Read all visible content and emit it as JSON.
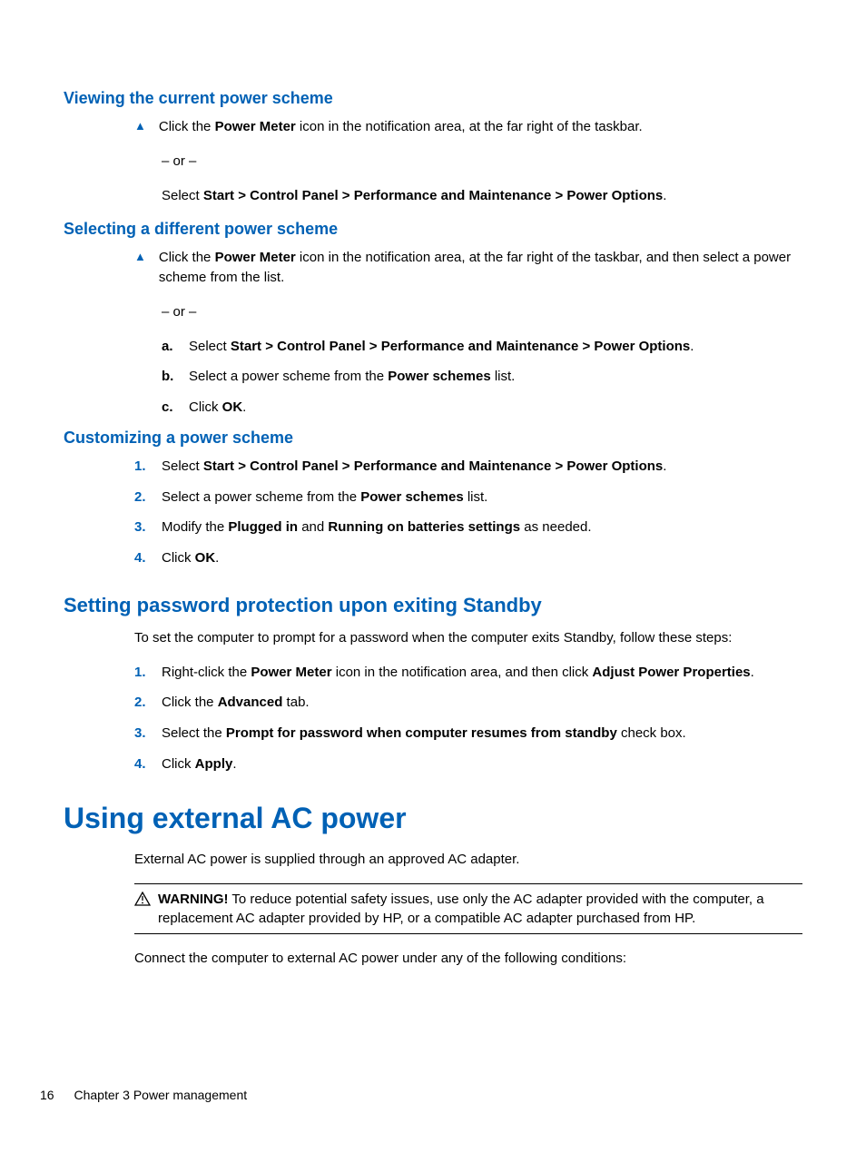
{
  "sec1": {
    "heading": "Viewing the current power scheme",
    "bullet_pre": "Click the ",
    "bullet_b1": "Power Meter",
    "bullet_post": " icon in the notification area, at the far right of the taskbar.",
    "or": "– or –",
    "line2_pre": "Select ",
    "line2_b": "Start > Control Panel > Performance and Maintenance > Power Options",
    "line2_post": "."
  },
  "sec2": {
    "heading": "Selecting a different power scheme",
    "bullet_pre": "Click the ",
    "bullet_b1": "Power Meter",
    "bullet_post": " icon in the notification area, at the far right of the taskbar, and then select a power scheme from the list.",
    "or": "– or –",
    "a_label": "a.",
    "a_pre": "Select ",
    "a_b": "Start > Control Panel > Performance and Maintenance > Power Options",
    "a_post": ".",
    "b_label": "b.",
    "b_pre": "Select a power scheme from the ",
    "b_b": "Power schemes",
    "b_post": " list.",
    "c_label": "c.",
    "c_pre": "Click ",
    "c_b": "OK",
    "c_post": "."
  },
  "sec3": {
    "heading": "Customizing a power scheme",
    "n1": "1.",
    "s1_pre": "Select ",
    "s1_b": "Start > Control Panel > Performance and Maintenance > Power Options",
    "s1_post": ".",
    "n2": "2.",
    "s2_pre": "Select a power scheme from the ",
    "s2_b": "Power schemes",
    "s2_post": " list.",
    "n3": "3.",
    "s3_pre": "Modify the ",
    "s3_b1": "Plugged in",
    "s3_mid": " and ",
    "s3_b2": "Running on batteries settings",
    "s3_post": " as needed.",
    "n4": "4.",
    "s4_pre": "Click ",
    "s4_b": "OK",
    "s4_post": "."
  },
  "sec4": {
    "heading": "Setting password protection upon exiting Standby",
    "intro": "To set the computer to prompt for a password when the computer exits Standby, follow these steps:",
    "n1": "1.",
    "s1_pre": "Right-click the ",
    "s1_b1": "Power Meter",
    "s1_mid": " icon in the notification area, and then click ",
    "s1_b2": "Adjust Power Properties",
    "s1_post": ".",
    "n2": "2.",
    "s2_pre": "Click the ",
    "s2_b": "Advanced",
    "s2_post": " tab.",
    "n3": "3.",
    "s3_pre": "Select the ",
    "s3_b": "Prompt for password when computer resumes from standby",
    "s3_post": " check box.",
    "n4": "4.",
    "s4_pre": "Click ",
    "s4_b": "Apply",
    "s4_post": "."
  },
  "sec5": {
    "heading": "Using external AC power",
    "intro": "External AC power is supplied through an approved AC adapter.",
    "warn_label": "WARNING!",
    "warn_text": "   To reduce potential safety issues, use only the AC adapter provided with the computer, a replacement AC adapter provided by HP, or a compatible AC adapter purchased from HP.",
    "after": "Connect the computer to external AC power under any of the following conditions:"
  },
  "footer": {
    "page": "16",
    "chapter": "Chapter 3   Power management"
  }
}
